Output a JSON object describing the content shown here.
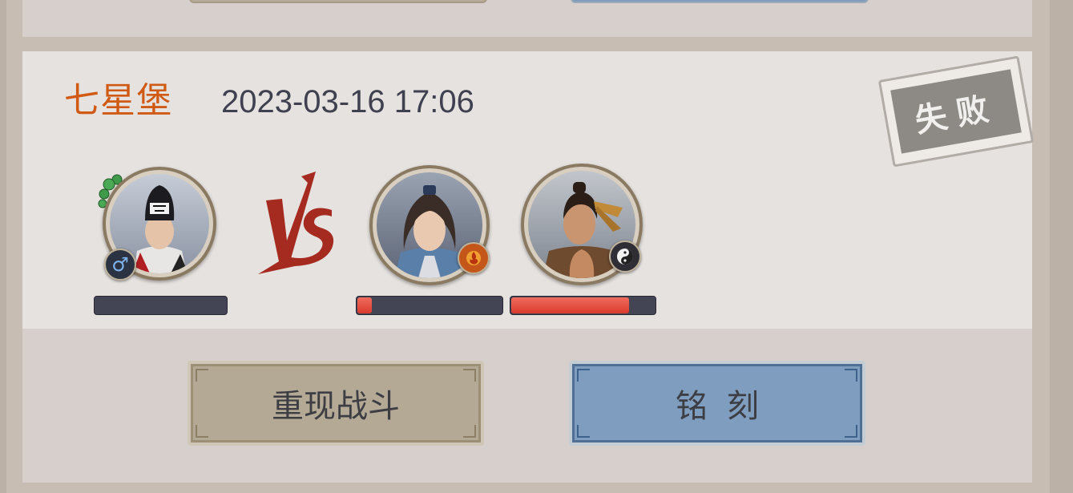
{
  "battle": {
    "location": "七星堡",
    "timestamp": "2023-03-16 17:06",
    "result": "失败",
    "vs_label": "VS"
  },
  "player": {
    "gender_symbol": "♂",
    "badge_icon": "male-gender-icon",
    "health_fraction": 0.0,
    "decoration_icon": "jade-beads-icon"
  },
  "opponents": [
    {
      "badge_icon": "flame-school-icon",
      "health_fraction": 0.1
    },
    {
      "badge_icon": "yin-yang-icon",
      "health_fraction": 0.82
    }
  ],
  "buttons": {
    "replay_label": "重现战斗",
    "engrave_label": "铭刻"
  },
  "colors": {
    "location": "#d05a14",
    "health_fill": "#e0463a",
    "replay_button": "#b4a995",
    "engrave_button": "#7f9dbe"
  }
}
